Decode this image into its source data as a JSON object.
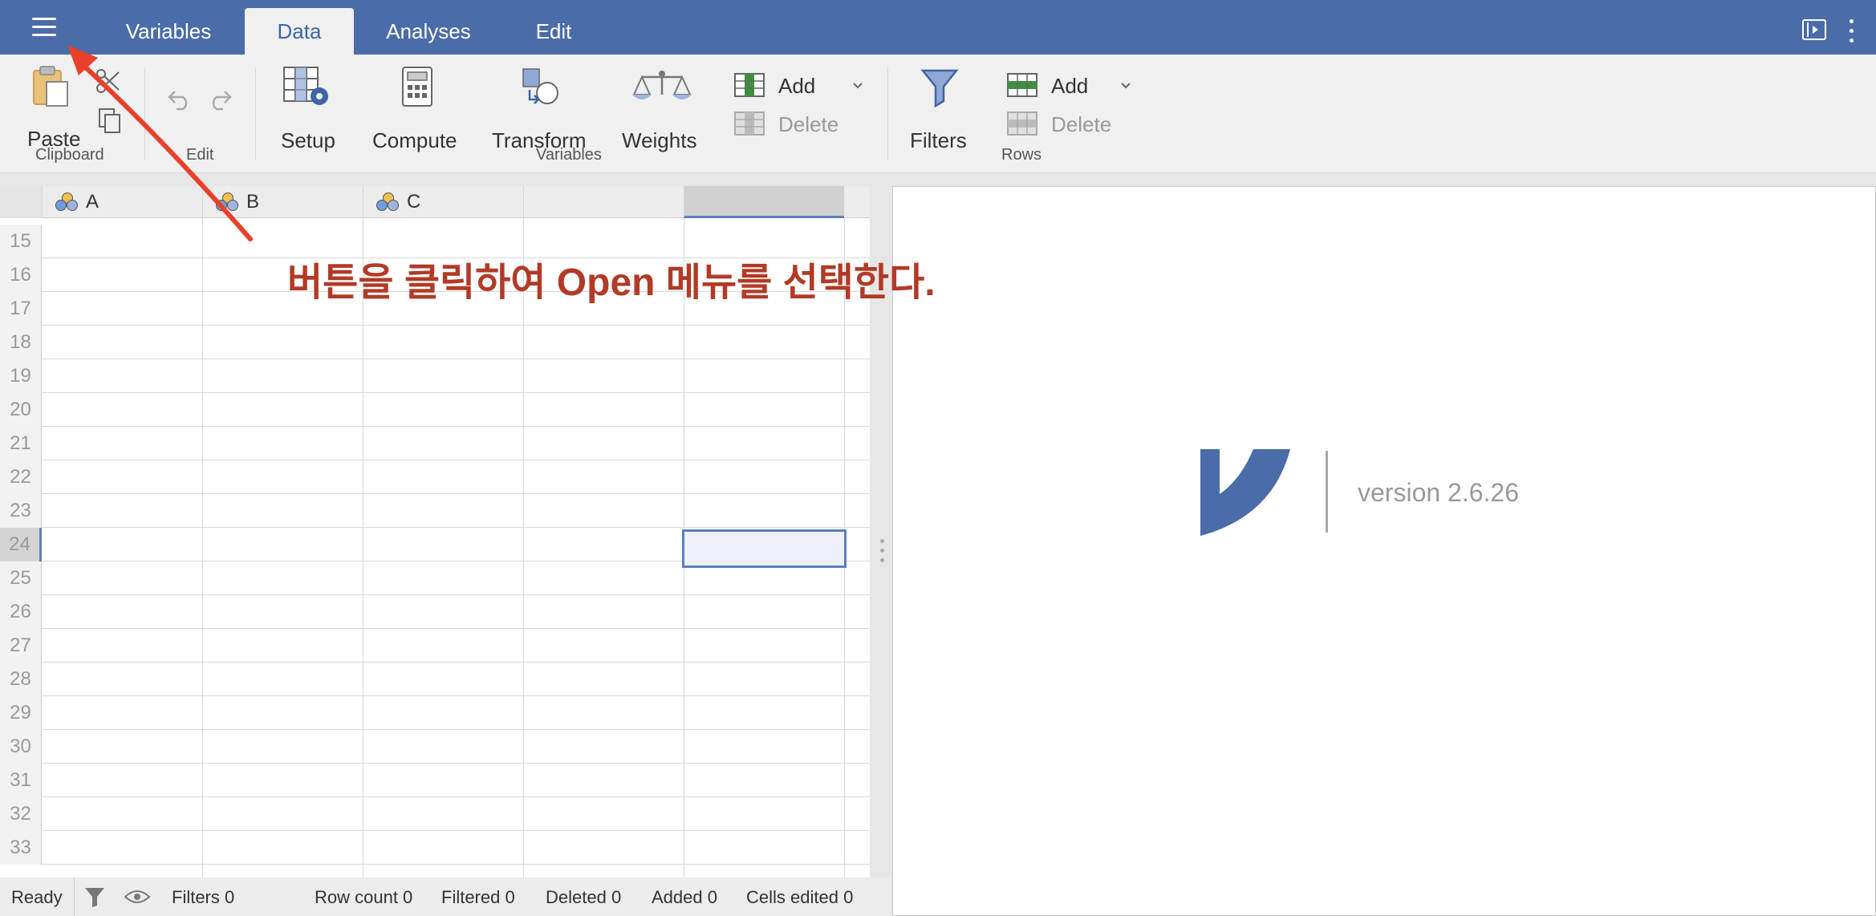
{
  "tabs": [
    {
      "label": "Variables"
    },
    {
      "label": "Data"
    },
    {
      "label": "Analyses"
    },
    {
      "label": "Edit"
    }
  ],
  "active_tab": "Data",
  "ribbon": {
    "clipboard": {
      "paste": "Paste",
      "group": "Clipboard"
    },
    "edit": {
      "group": "Edit"
    },
    "variables": {
      "setup": "Setup",
      "compute": "Compute",
      "transform": "Transform",
      "weights": "Weights",
      "add": "Add",
      "delete": "Delete",
      "group": "Variables"
    },
    "rows": {
      "filters": "Filters",
      "add": "Add",
      "delete": "Delete",
      "group": "Rows"
    }
  },
  "grid": {
    "columns": [
      "A",
      "B",
      "C",
      ""
    ],
    "row_numbers": [
      "15",
      "16",
      "17",
      "18",
      "19",
      "20",
      "21",
      "22",
      "23",
      "24",
      "25",
      "26",
      "27",
      "28",
      "29",
      "30",
      "31",
      "32",
      "33"
    ],
    "selected_row": "24"
  },
  "status": {
    "ready": "Ready",
    "filters": "Filters 0",
    "row_count": "Row count 0",
    "filtered": "Filtered 0",
    "deleted": "Deleted 0",
    "added": "Added 0",
    "cells_edited": "Cells edited 0"
  },
  "results": {
    "version": "version 2.6.26"
  },
  "annotation": {
    "text": "버튼을 클릭하여 Open 메뉴를 선택한다."
  },
  "colors": {
    "topbar": "#4a6ca8",
    "accent": "#5b80bf",
    "annotation": "#b23a26",
    "logo": "#4a6ca8"
  },
  "icons": [
    "hamburger-menu-icon",
    "paste-icon",
    "cut-icon",
    "copy-icon",
    "undo-icon",
    "redo-icon",
    "setup-icon",
    "compute-icon",
    "transform-icon",
    "weights-icon",
    "add-variable-icon",
    "delete-variable-icon",
    "filter-icon",
    "add-row-icon",
    "delete-row-icon",
    "eye-icon",
    "mode-toggle-icon",
    "more-options-icon",
    "jamovi-logo"
  ]
}
